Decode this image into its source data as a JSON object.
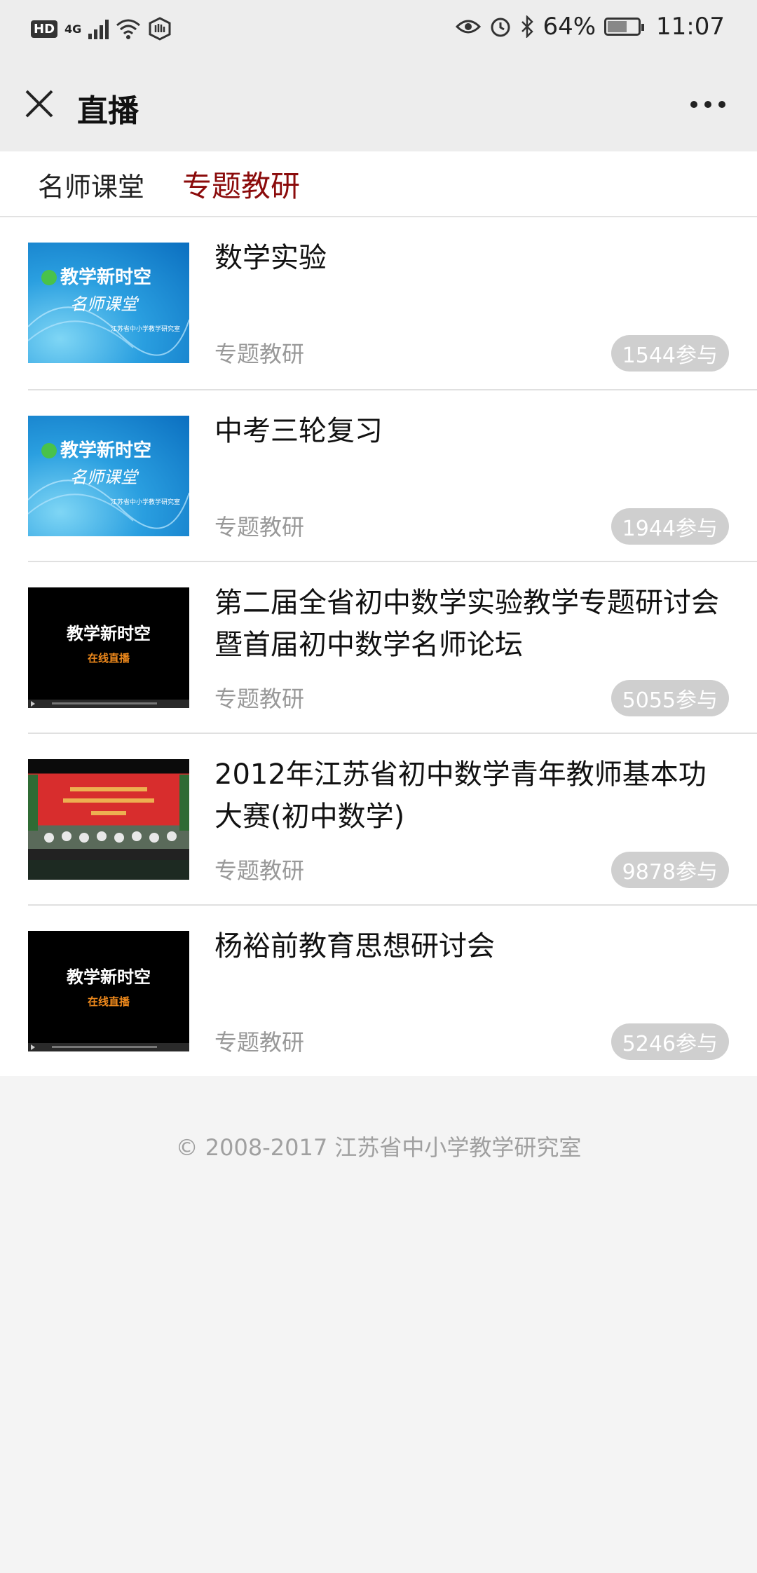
{
  "status_bar": {
    "network": "4G",
    "hd": "HD",
    "battery": "64%",
    "battery_level": 0.64,
    "time": "11:07"
  },
  "nav": {
    "title": "直播"
  },
  "tabs": [
    {
      "label": "名师课堂",
      "active": false
    },
    {
      "label": "专题教研",
      "active": true
    }
  ],
  "items": [
    {
      "title": "数学实验",
      "tag": "专题教研",
      "count": "1544参与",
      "thumb": {
        "line1": "教学新时空",
        "line2": "名师课堂",
        "line3": "江苏省中小学教学研究室"
      }
    },
    {
      "title": "中考三轮复习",
      "tag": "专题教研",
      "count": "1944参与",
      "thumb": {
        "line1": "教学新时空",
        "line2": "名师课堂",
        "line3": "江苏省中小学教学研究室"
      }
    },
    {
      "title": "第二届全省初中数学实验教学专题研讨会暨首届初中数学名师论坛",
      "tag": "专题教研",
      "count": "5055参与",
      "thumb": {
        "line1": "教学新时空",
        "line2": "在线直播"
      }
    },
    {
      "title": "2012年江苏省初中数学青年教师基本功大赛(初中数学)",
      "tag": "专题教研",
      "count": "9878参与",
      "thumb": {}
    },
    {
      "title": "杨裕前教育思想研讨会",
      "tag": "专题教研",
      "count": "5246参与",
      "thumb": {
        "line1": "教学新时空",
        "line2": "在线直播"
      }
    }
  ],
  "footer": {
    "copyright": "© 2008-2017 江苏省中小学教学研究室"
  }
}
